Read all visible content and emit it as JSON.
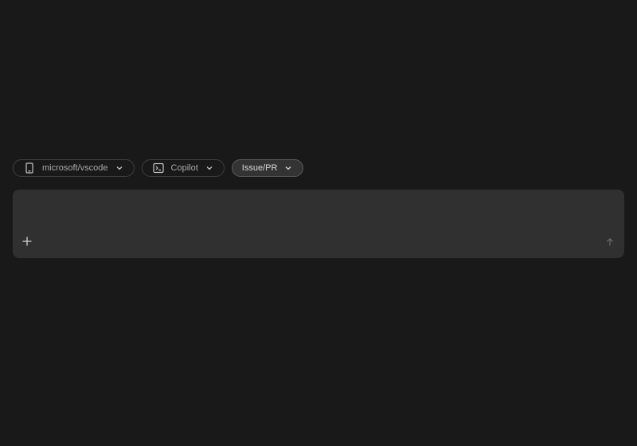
{
  "selectors": [
    {
      "label": "microsoft/vscode",
      "icon": "device-icon",
      "selected": false
    },
    {
      "label": "Copilot",
      "icon": "terminal-icon",
      "selected": false
    },
    {
      "label": "Issue/PR",
      "icon": null,
      "selected": true
    }
  ],
  "composer": {
    "placeholder": "",
    "value": "",
    "add_icon": "plus-icon",
    "send_icon": "arrow-up-icon"
  },
  "colors": {
    "background": "#191919",
    "composer": "#303030",
    "pill_border": "#3f3f3f",
    "pill_selected": "#333333",
    "text": "#a9a9a9"
  }
}
